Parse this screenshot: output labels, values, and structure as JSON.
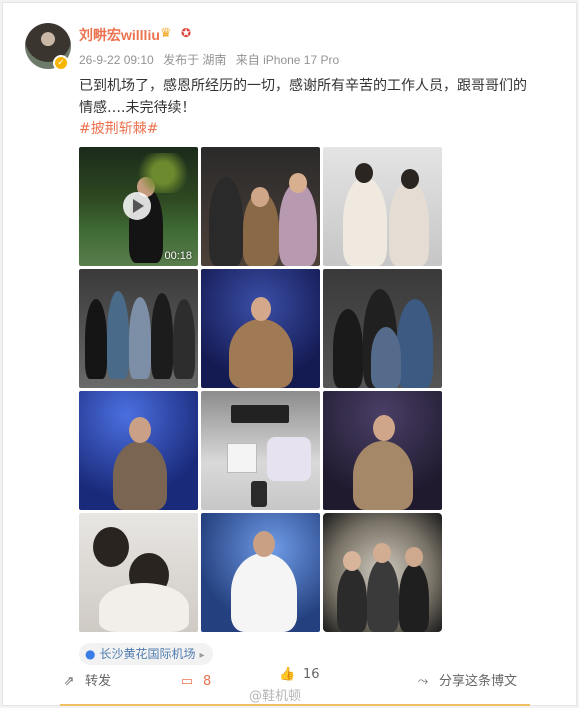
{
  "author": {
    "name": "刘畊宏willliu",
    "avatar_icon": "avatar-photo",
    "verified_icon": "verified-badge-icon",
    "crown_icon": "crown-icon",
    "medal_icon": "medal-icon"
  },
  "meta": {
    "time": "26-9-22 09:10",
    "posted_from": "发布于 湖南",
    "device": "来自 iPhone 17 Pro"
  },
  "post": {
    "text": "已到机场了，感恩所经历的一切，感谢所有辛苦的工作人员，跟哥哥们的情感….未完待续！",
    "hashtag": "#披荆斩棘#"
  },
  "media": {
    "video_duration": "00:18",
    "count": 12
  },
  "location": {
    "label": "长沙黄花国际机场",
    "icon": "location-pin-icon"
  },
  "actions": {
    "repost_label": "转发",
    "comment_count": "8",
    "like_count": "16",
    "share_label": "分享这条博文"
  },
  "watermark": "@鞋机顿",
  "colors": {
    "accent": "#eb7350",
    "link": "#507daf",
    "meta": "#939393"
  }
}
